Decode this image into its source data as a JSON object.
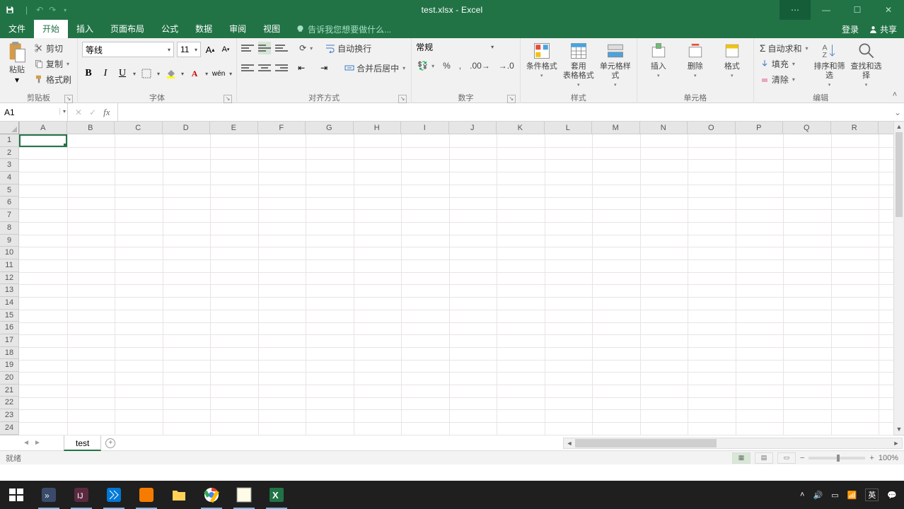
{
  "titlebar": {
    "title": "test.xlsx - Excel"
  },
  "tabs": {
    "file": "文件",
    "items": [
      "开始",
      "插入",
      "页面布局",
      "公式",
      "数据",
      "审阅",
      "视图"
    ],
    "active_index": 0,
    "tellme": "告诉我您想要做什么...",
    "login": "登录",
    "share": "共享"
  },
  "ribbon": {
    "clipboard": {
      "paste": "粘贴",
      "cut": "剪切",
      "copy": "复制",
      "painter": "格式刷",
      "label": "剪贴板"
    },
    "font": {
      "name": "等线",
      "size": "11",
      "label": "字体"
    },
    "alignment": {
      "wrap": "自动换行",
      "merge": "合并后居中",
      "label": "对齐方式"
    },
    "number": {
      "format": "常规",
      "label": "数字"
    },
    "styles": {
      "cond": "条件格式",
      "table": "套用\n表格格式",
      "cell": "单元格样式",
      "label": "样式"
    },
    "cells": {
      "insert": "插入",
      "delete": "删除",
      "format": "格式",
      "label": "单元格"
    },
    "editing": {
      "sum": "自动求和",
      "fill": "填充",
      "clear": "清除",
      "sort": "排序和筛选",
      "find": "查找和选择",
      "label": "编辑"
    }
  },
  "namebox": "A1",
  "columns": [
    "A",
    "B",
    "C",
    "D",
    "E",
    "F",
    "G",
    "H",
    "I",
    "J",
    "K",
    "L",
    "M",
    "N",
    "O",
    "P",
    "Q",
    "R"
  ],
  "rows": [
    "1",
    "2",
    "3",
    "4",
    "5",
    "6",
    "7",
    "8",
    "9",
    "10",
    "11",
    "12",
    "13",
    "14",
    "15",
    "16",
    "17",
    "18",
    "19",
    "20",
    "21",
    "22",
    "23",
    "24"
  ],
  "sheet": {
    "active_tab": "test"
  },
  "status": {
    "ready": "就绪",
    "zoom": "100%"
  },
  "taskbar": {
    "ime": "英"
  }
}
